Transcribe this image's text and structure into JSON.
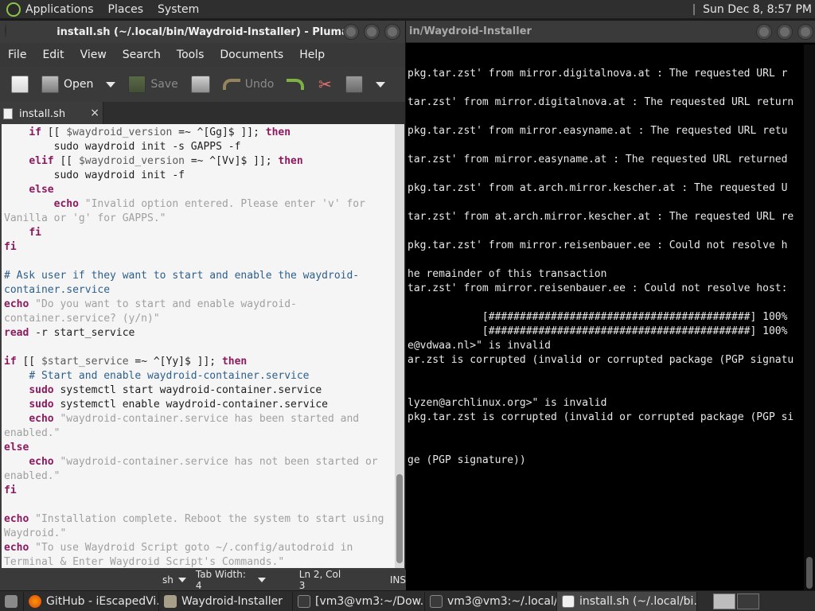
{
  "top_panel": {
    "menus": [
      "Applications",
      "Places",
      "System"
    ],
    "clock": "Sun Dec  8,  8:57 PM"
  },
  "terminal": {
    "title": "in/Waydroid-Installer",
    "lines": [
      "pkg.tar.zst' from mirror.digitalnova.at : The requested URL r",
      "",
      "tar.zst' from mirror.digitalnova.at : The requested URL return",
      "",
      "pkg.tar.zst' from mirror.easyname.at : The requested URL retu",
      "",
      "tar.zst' from mirror.easyname.at : The requested URL returned",
      "",
      "pkg.tar.zst' from at.arch.mirror.kescher.at : The requested U",
      "",
      "tar.zst' from at.arch.mirror.kescher.at : The requested URL re",
      "",
      "pkg.tar.zst' from mirror.reisenbauer.ee : Could not resolve h",
      "",
      "he remainder of this transaction",
      "tar.zst' from mirror.reisenbauer.ee : Could not resolve host:",
      "",
      "            [##########################################] 100%",
      "            [##########################################] 100%",
      "e@vdwaa.nl>\" is invalid",
      "ar.zst is corrupted (invalid or corrupted package (PGP signatu",
      "",
      "",
      "lyzen@archlinux.org>\" is invalid",
      "pkg.tar.zst is corrupted (invalid or corrupted package (PGP si",
      "",
      "",
      "ge (PGP signature))"
    ]
  },
  "pluma": {
    "title": "install.sh (~/.local/bin/Waydroid-Installer) - Pluma",
    "menu": [
      "File",
      "Edit",
      "View",
      "Search",
      "Tools",
      "Documents",
      "Help"
    ],
    "toolbar": {
      "open": "Open",
      "save": "Save",
      "undo": "Undo"
    },
    "tab": "install.sh",
    "tab_close": "×",
    "code_lines": [
      [
        [
          "t",
          "    "
        ],
        [
          "k",
          "if"
        ],
        [
          "t",
          " [[ "
        ],
        [
          "v",
          "$waydroid_version"
        ],
        [
          "t",
          " =~ ^[Gg]$ ]]; "
        ],
        [
          "k",
          "then"
        ]
      ],
      [
        [
          "t",
          "        sudo waydroid init -s GAPPS -f"
        ]
      ],
      [
        [
          "t",
          "    "
        ],
        [
          "k",
          "elif"
        ],
        [
          "t",
          " [[ "
        ],
        [
          "v",
          "$waydroid_version"
        ],
        [
          "t",
          " =~ ^[Vv]$ ]]; "
        ],
        [
          "k",
          "then"
        ]
      ],
      [
        [
          "t",
          "        sudo waydroid init -f"
        ]
      ],
      [
        [
          "t",
          "    "
        ],
        [
          "k",
          "else"
        ]
      ],
      [
        [
          "t",
          "        "
        ],
        [
          "k",
          "echo"
        ],
        [
          "s",
          " \"Invalid option entered. Please enter 'v' for"
        ]
      ],
      [
        [
          "s",
          "Vanilla or 'g' for GAPPS.\""
        ]
      ],
      [
        [
          "t",
          "    "
        ],
        [
          "k",
          "fi"
        ]
      ],
      [
        [
          "k",
          "fi"
        ]
      ],
      [
        [
          "t",
          ""
        ]
      ],
      [
        [
          "c",
          "# Ask user if they want to start and enable the waydroid-"
        ]
      ],
      [
        [
          "c",
          "container.service"
        ]
      ],
      [
        [
          "k",
          "echo"
        ],
        [
          "s",
          " \"Do you want to start and enable waydroid-"
        ]
      ],
      [
        [
          "s",
          "container.service? (y/n)\""
        ]
      ],
      [
        [
          "k",
          "read"
        ],
        [
          "t",
          " -r start_service"
        ]
      ],
      [
        [
          "t",
          ""
        ]
      ],
      [
        [
          "k",
          "if"
        ],
        [
          "t",
          " [[ "
        ],
        [
          "v",
          "$start_service"
        ],
        [
          "t",
          " =~ ^[Yy]$ ]]; "
        ],
        [
          "k",
          "then"
        ]
      ],
      [
        [
          "t",
          "    "
        ],
        [
          "c",
          "# Start and enable waydroid-container.service"
        ]
      ],
      [
        [
          "t",
          "    "
        ],
        [
          "k",
          "sudo"
        ],
        [
          "t",
          " systemctl start waydroid-container.service"
        ]
      ],
      [
        [
          "t",
          "    "
        ],
        [
          "k",
          "sudo"
        ],
        [
          "t",
          " systemctl enable waydroid-container.service"
        ]
      ],
      [
        [
          "t",
          "    "
        ],
        [
          "k",
          "echo"
        ],
        [
          "s",
          " \"waydroid-container.service has been started and"
        ]
      ],
      [
        [
          "s",
          "enabled.\""
        ]
      ],
      [
        [
          "k",
          "else"
        ]
      ],
      [
        [
          "t",
          "    "
        ],
        [
          "k",
          "echo"
        ],
        [
          "s",
          " \"waydroid-container.service has not been started or"
        ]
      ],
      [
        [
          "s",
          "enabled.\""
        ]
      ],
      [
        [
          "k",
          "fi"
        ]
      ],
      [
        [
          "t",
          ""
        ]
      ],
      [
        [
          "k",
          "echo"
        ],
        [
          "s",
          " \"Installation complete. Reboot the system to start using"
        ]
      ],
      [
        [
          "s",
          "Waydroid.\""
        ]
      ],
      [
        [
          "k",
          "echo"
        ],
        [
          "s",
          " \"To use Waydroid Script goto ~/.config/autodroid in"
        ]
      ],
      [
        [
          "s",
          "Terminal & Enter Waydroid Script's Commands.\""
        ]
      ]
    ],
    "status": {
      "lang": "sh",
      "tab_width": "Tab Width: 4",
      "position": "Ln 2, Col 3",
      "mode": "INS"
    }
  },
  "taskbar": {
    "items": [
      "GitHub - iEscapedVi...",
      "Waydroid-Installer",
      "[vm3@vm3:~/Dow...",
      "vm3@vm3:~/.local/...",
      "install.sh (~/.local/bi..."
    ]
  }
}
